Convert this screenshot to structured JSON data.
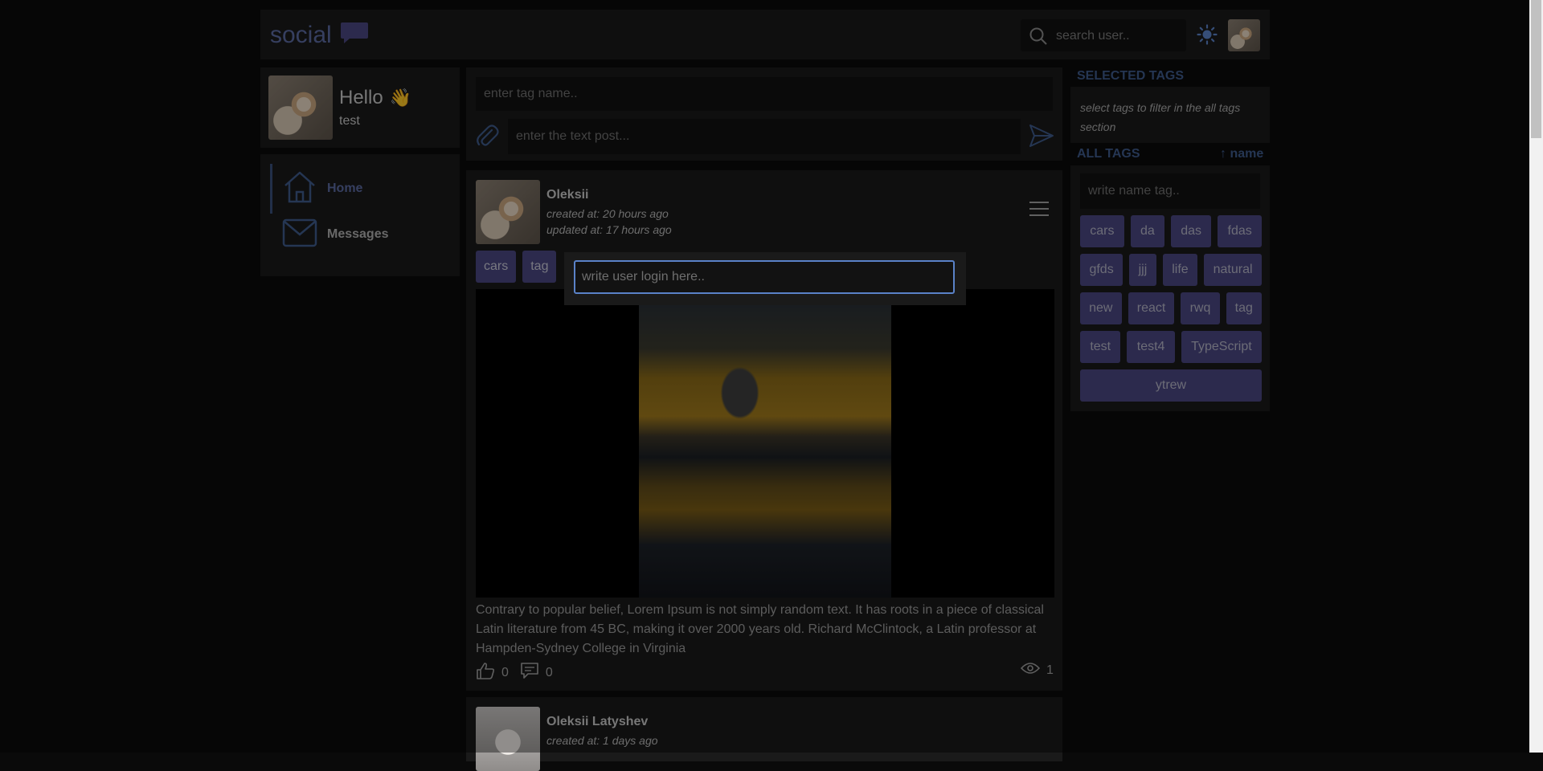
{
  "header": {
    "logo_text": "social",
    "search_placeholder": "search user..",
    "icons": [
      "chat-bubble-icon",
      "search-icon",
      "sun-icon"
    ]
  },
  "profile": {
    "greeting": "Hello",
    "wave": "👋",
    "username": "test"
  },
  "nav": {
    "items": [
      {
        "label": "Home",
        "icon": "home-icon",
        "active": true
      },
      {
        "label": "Messages",
        "icon": "mail-icon",
        "active": false
      }
    ]
  },
  "composer": {
    "tag_placeholder": "enter tag name..",
    "text_placeholder": "enter the text post..."
  },
  "post": {
    "author": "Oleksii",
    "created": "created at: 20 hours ago",
    "updated": "updated at: 17 hours ago",
    "tags": [
      "cars",
      "tag"
    ],
    "text": "Contrary to popular belief, Lorem Ipsum is not simply random text. It has roots in a piece of classical Latin literature from 45 BC, making it over 2000 years old. Richard McClintock, a Latin professor at Hampden-Sydney College in Virginia",
    "likes": "0",
    "comments": "0",
    "views": "1"
  },
  "post2": {
    "author": "Oleksii Latyshev",
    "created": "created at: 1 days ago"
  },
  "sidebar": {
    "selected_title": "SELECTED TAGS",
    "selected_hint": "select tags to filter in the all tags section",
    "all_title": "ALL TAGS",
    "sort_label": "↑ name",
    "filter_placeholder": "write name tag..",
    "tags": [
      "cars",
      "da",
      "das",
      "fdas",
      "gfds",
      "jjj",
      "life",
      "natural",
      "new",
      "react",
      "rwq",
      "tag",
      "test",
      "test4",
      "TypeScript",
      "ytrew"
    ]
  },
  "popup": {
    "placeholder": "write user login here.."
  },
  "colors": {
    "accent": "#5a6aa0",
    "tag_bg": "#4a4780",
    "focus_border": "#5a82c8",
    "panel": "#1a1a1a"
  }
}
